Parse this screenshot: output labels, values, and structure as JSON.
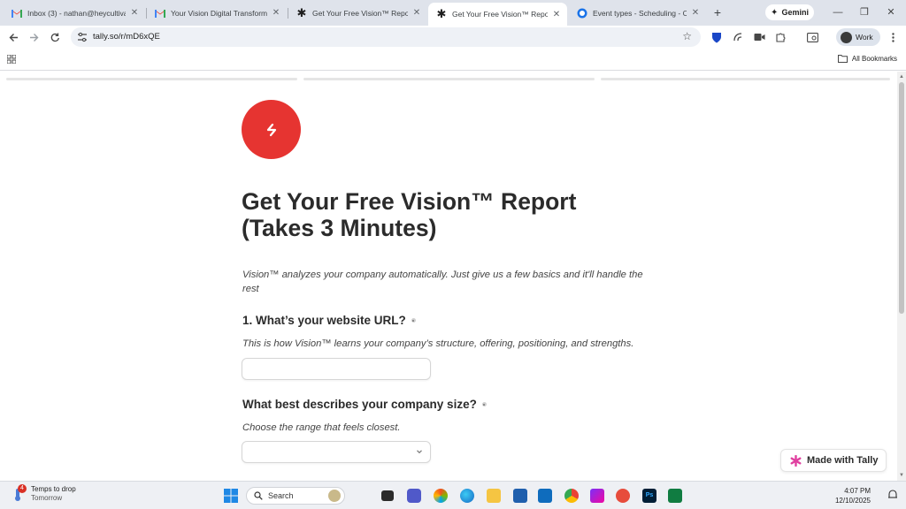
{
  "browser": {
    "tabs": [
      {
        "title": "Inbox (3) - nathan@heycultivat",
        "icon": "gmail-icon",
        "active": false
      },
      {
        "title": "Your Vision Digital Transformati",
        "icon": "gmail-icon",
        "active": false
      },
      {
        "title": "Get Your Free Vision™ Report (T",
        "icon": "tally-icon",
        "active": false
      },
      {
        "title": "Get Your Free Vision™ Report (T",
        "icon": "tally-icon",
        "active": true
      },
      {
        "title": "Event types - Scheduling - Cale",
        "icon": "calendar-icon",
        "active": false
      }
    ],
    "gemini_label": "Gemini",
    "url": "tally.so/r/mD6xQE",
    "profile_label": "Work",
    "all_bookmarks_label": "All Bookmarks"
  },
  "form": {
    "title": "Get Your Free Vision™ Report (Takes 3 Minutes)",
    "intro": "Vision™ analyzes your company automatically. Just give us a few basics and it'll handle the rest",
    "q1_label": "1. What’s your website URL?",
    "q1_help": "This is how Vision™ learns your company’s structure, offering, positioning, and strengths.",
    "q1_value": "",
    "q2_label": "What best describes your company size?",
    "q2_help": "Choose the range that feels closest.",
    "q2_value": "",
    "brand_color": "#e63431"
  },
  "badge": {
    "label": "Made with Tally"
  },
  "taskbar": {
    "weather_title": "Temps to drop",
    "weather_sub": "Tomorrow",
    "weather_badge": "4",
    "search_label": "Search",
    "time": "4:07 PM",
    "date": "12/10/2025"
  }
}
